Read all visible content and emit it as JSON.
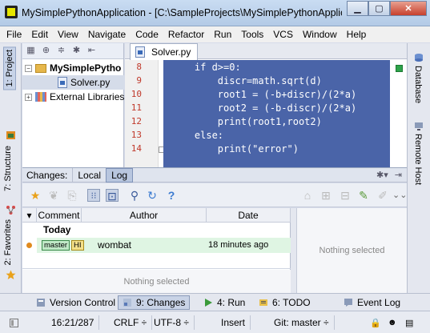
{
  "window": {
    "title": "MySimplePythonApplication - [C:\\SampleProjects\\MySimplePythonApplic...",
    "minimize": "▁",
    "maximize": "▢",
    "close": "✕"
  },
  "menu": [
    "File",
    "Edit",
    "View",
    "Navigate",
    "Code",
    "Refactor",
    "Run",
    "Tools",
    "VCS",
    "Window",
    "Help"
  ],
  "left_stripe": {
    "project_tab": "1: Project",
    "structure_tab": "7: Structure",
    "favorites_tab": "2: Favorites"
  },
  "right_stripe": {
    "database_tab": "Database",
    "remote_host_tab": "Remote Host"
  },
  "project_tree": {
    "root": "MySimplePytho",
    "file": "Solver.py",
    "libraries": "External Libraries"
  },
  "editor": {
    "tab_label": "Solver.py",
    "line_numbers": [
      "8",
      "9",
      "10",
      "11",
      "12",
      "13",
      "14"
    ],
    "lines": [
      "    if d>=0:",
      "        discr=math.sqrt(d)",
      "        root1 = (-b+discr)/(2*a)",
      "        root2 = (-b-discr)/(2*a)",
      "        print(root1,root2)",
      "    else:",
      "        print(\"error\")"
    ],
    "code_bg": "#4a64a8"
  },
  "changes": {
    "label": "Changes:",
    "tabs": [
      "Local",
      "Log"
    ],
    "active_tab": "Log",
    "columns": [
      "Comment",
      "Author",
      "Date"
    ],
    "group_today": "Today",
    "commit": {
      "branch_tag": "master",
      "head_tag": "HI",
      "author": "wombat",
      "date": "18 minutes ago"
    },
    "nothing_selected_bottom": "Nothing selected",
    "nothing_selected_right": "Nothing selected"
  },
  "tool_windows": [
    {
      "label": "Version Control",
      "icon": "version-control-icon"
    },
    {
      "label": "9: Changes",
      "icon": "changes-icon",
      "active": true
    },
    {
      "label": "4: Run",
      "icon": "run-icon"
    },
    {
      "label": "6: TODO",
      "icon": "todo-icon"
    },
    {
      "label": "Event Log",
      "icon": "event-log-icon"
    }
  ],
  "status": {
    "position": "16:21/287",
    "line_separator": "CRLF ÷",
    "encoding": "UTF-8 ÷",
    "insert_mode": "Insert",
    "vcs_branch": "Git: master ÷"
  },
  "colors": {
    "accent_selection": "#4a64a8",
    "commit_row": "#dff5e3",
    "line_number": "#c0392b"
  }
}
